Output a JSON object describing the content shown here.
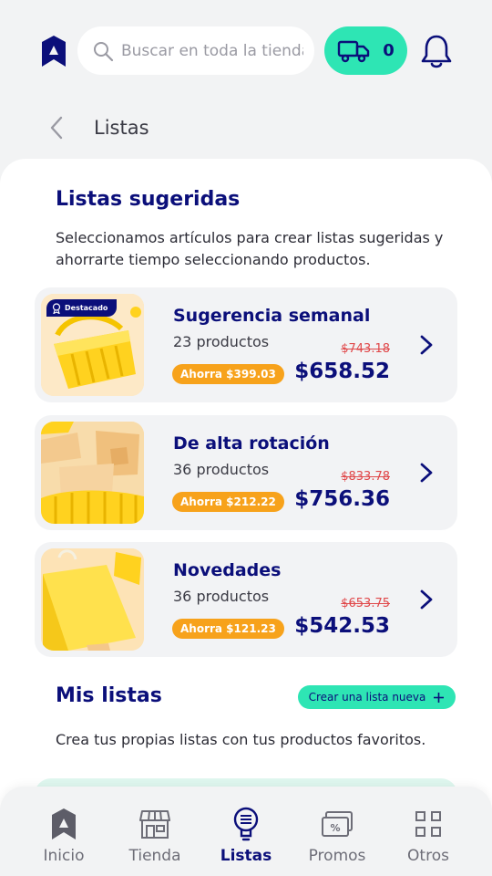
{
  "header": {
    "search_placeholder": "Buscar en toda la tienda",
    "cart_count": "0"
  },
  "breadcrumb": {
    "title": "Listas"
  },
  "suggested": {
    "title": "Listas sugeridas",
    "description": "Seleccionamos artículos para crear listas sugeridas y ahorrarte tiempo seleccionando productos.",
    "featured_badge": "Destacado",
    "cards": [
      {
        "title": "Sugerencia semanal",
        "count": "23 productos",
        "savings": "Ahorra $399.03",
        "old_price": "$743.18",
        "price": "$658.52",
        "image": "yellow-basket"
      },
      {
        "title": "De alta rotación",
        "count": "36 productos",
        "savings": "Ahorra $212.22",
        "old_price": "$833.78",
        "price": "$756.36",
        "image": "boxes-in-basket"
      },
      {
        "title": "Novedades",
        "count": "36 productos",
        "savings": "Ahorra $121.23",
        "old_price": "$653.75",
        "price": "$542.53",
        "image": "yellow-shopping-bag"
      }
    ]
  },
  "my_lists": {
    "title": "Mis listas",
    "create_button": "Crear una lista nueva",
    "description": "Crea tus propias listas con tus productos favoritos."
  },
  "nav": [
    {
      "label": "Inicio",
      "icon": "home-icon"
    },
    {
      "label": "Tienda",
      "icon": "store-icon"
    },
    {
      "label": "Listas",
      "icon": "lightbulb-icon",
      "active": true
    },
    {
      "label": "Promos",
      "icon": "promo-icon"
    },
    {
      "label": "Otros",
      "icon": "grid-icon"
    }
  ],
  "colors": {
    "brand_navy": "#0b0f7a",
    "accent_green": "#2ee5b4",
    "savings_orange": "#f7a21b",
    "old_price_red": "#e0484a"
  }
}
